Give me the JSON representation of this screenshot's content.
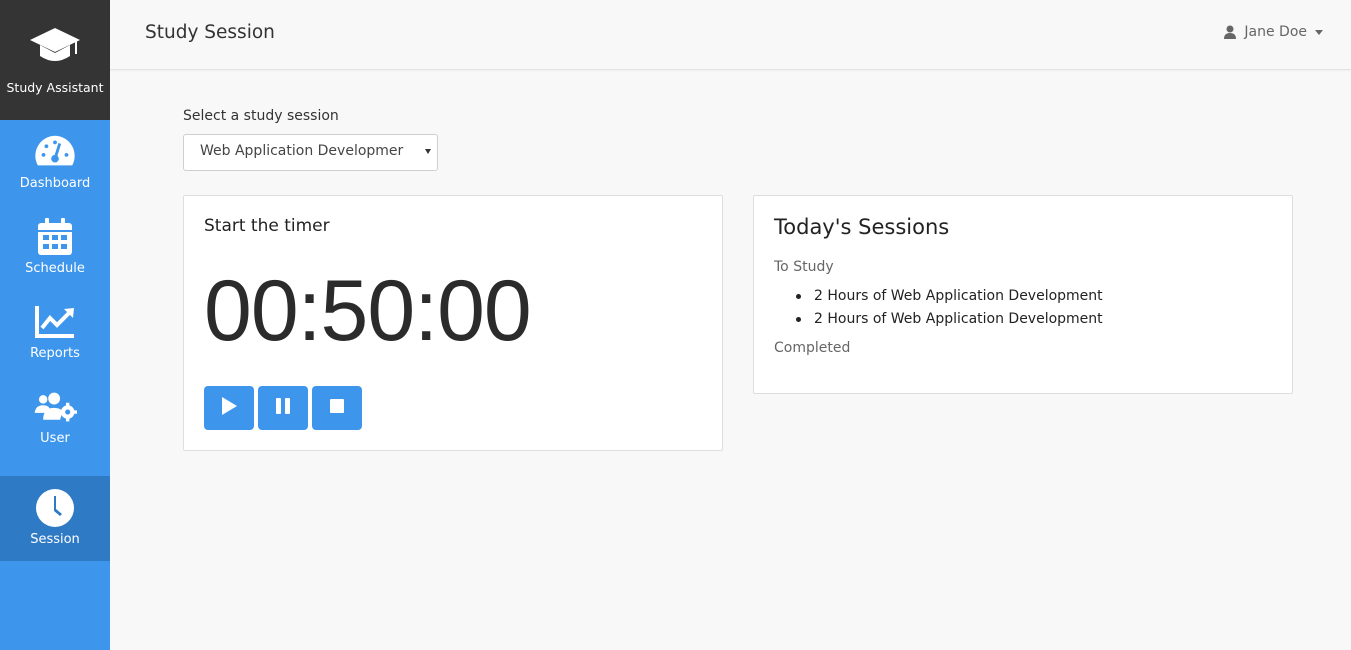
{
  "app": {
    "brand_label": "Study Assistant"
  },
  "sidebar": {
    "items": [
      {
        "label": "Dashboard",
        "icon": "tachometer-icon"
      },
      {
        "label": "Schedule",
        "icon": "calendar-icon"
      },
      {
        "label": "Reports",
        "icon": "chart-line-icon"
      },
      {
        "label": "User",
        "icon": "users-cog-icon"
      },
      {
        "label": "Session",
        "icon": "clock-icon",
        "active": true
      }
    ]
  },
  "header": {
    "title": "Study Session",
    "user_name": "Jane Doe"
  },
  "session_select": {
    "label": "Select a study session",
    "value": "Web Application Developmer"
  },
  "timer": {
    "title": "Start the timer",
    "time": "00:50:00",
    "buttons": [
      "play-icon",
      "pause-icon",
      "stop-icon"
    ]
  },
  "sessions": {
    "title": "Today's Sessions",
    "to_study_label": "To Study",
    "to_study_items": [
      "2 Hours of Web Application Development",
      "2 Hours of Web Application Development"
    ],
    "completed_label": "Completed"
  },
  "colors": {
    "sidebar": "#3d96ec",
    "sidebar_active": "#2f7ac4",
    "brand_bg": "#343434",
    "button": "#3d96ec"
  }
}
